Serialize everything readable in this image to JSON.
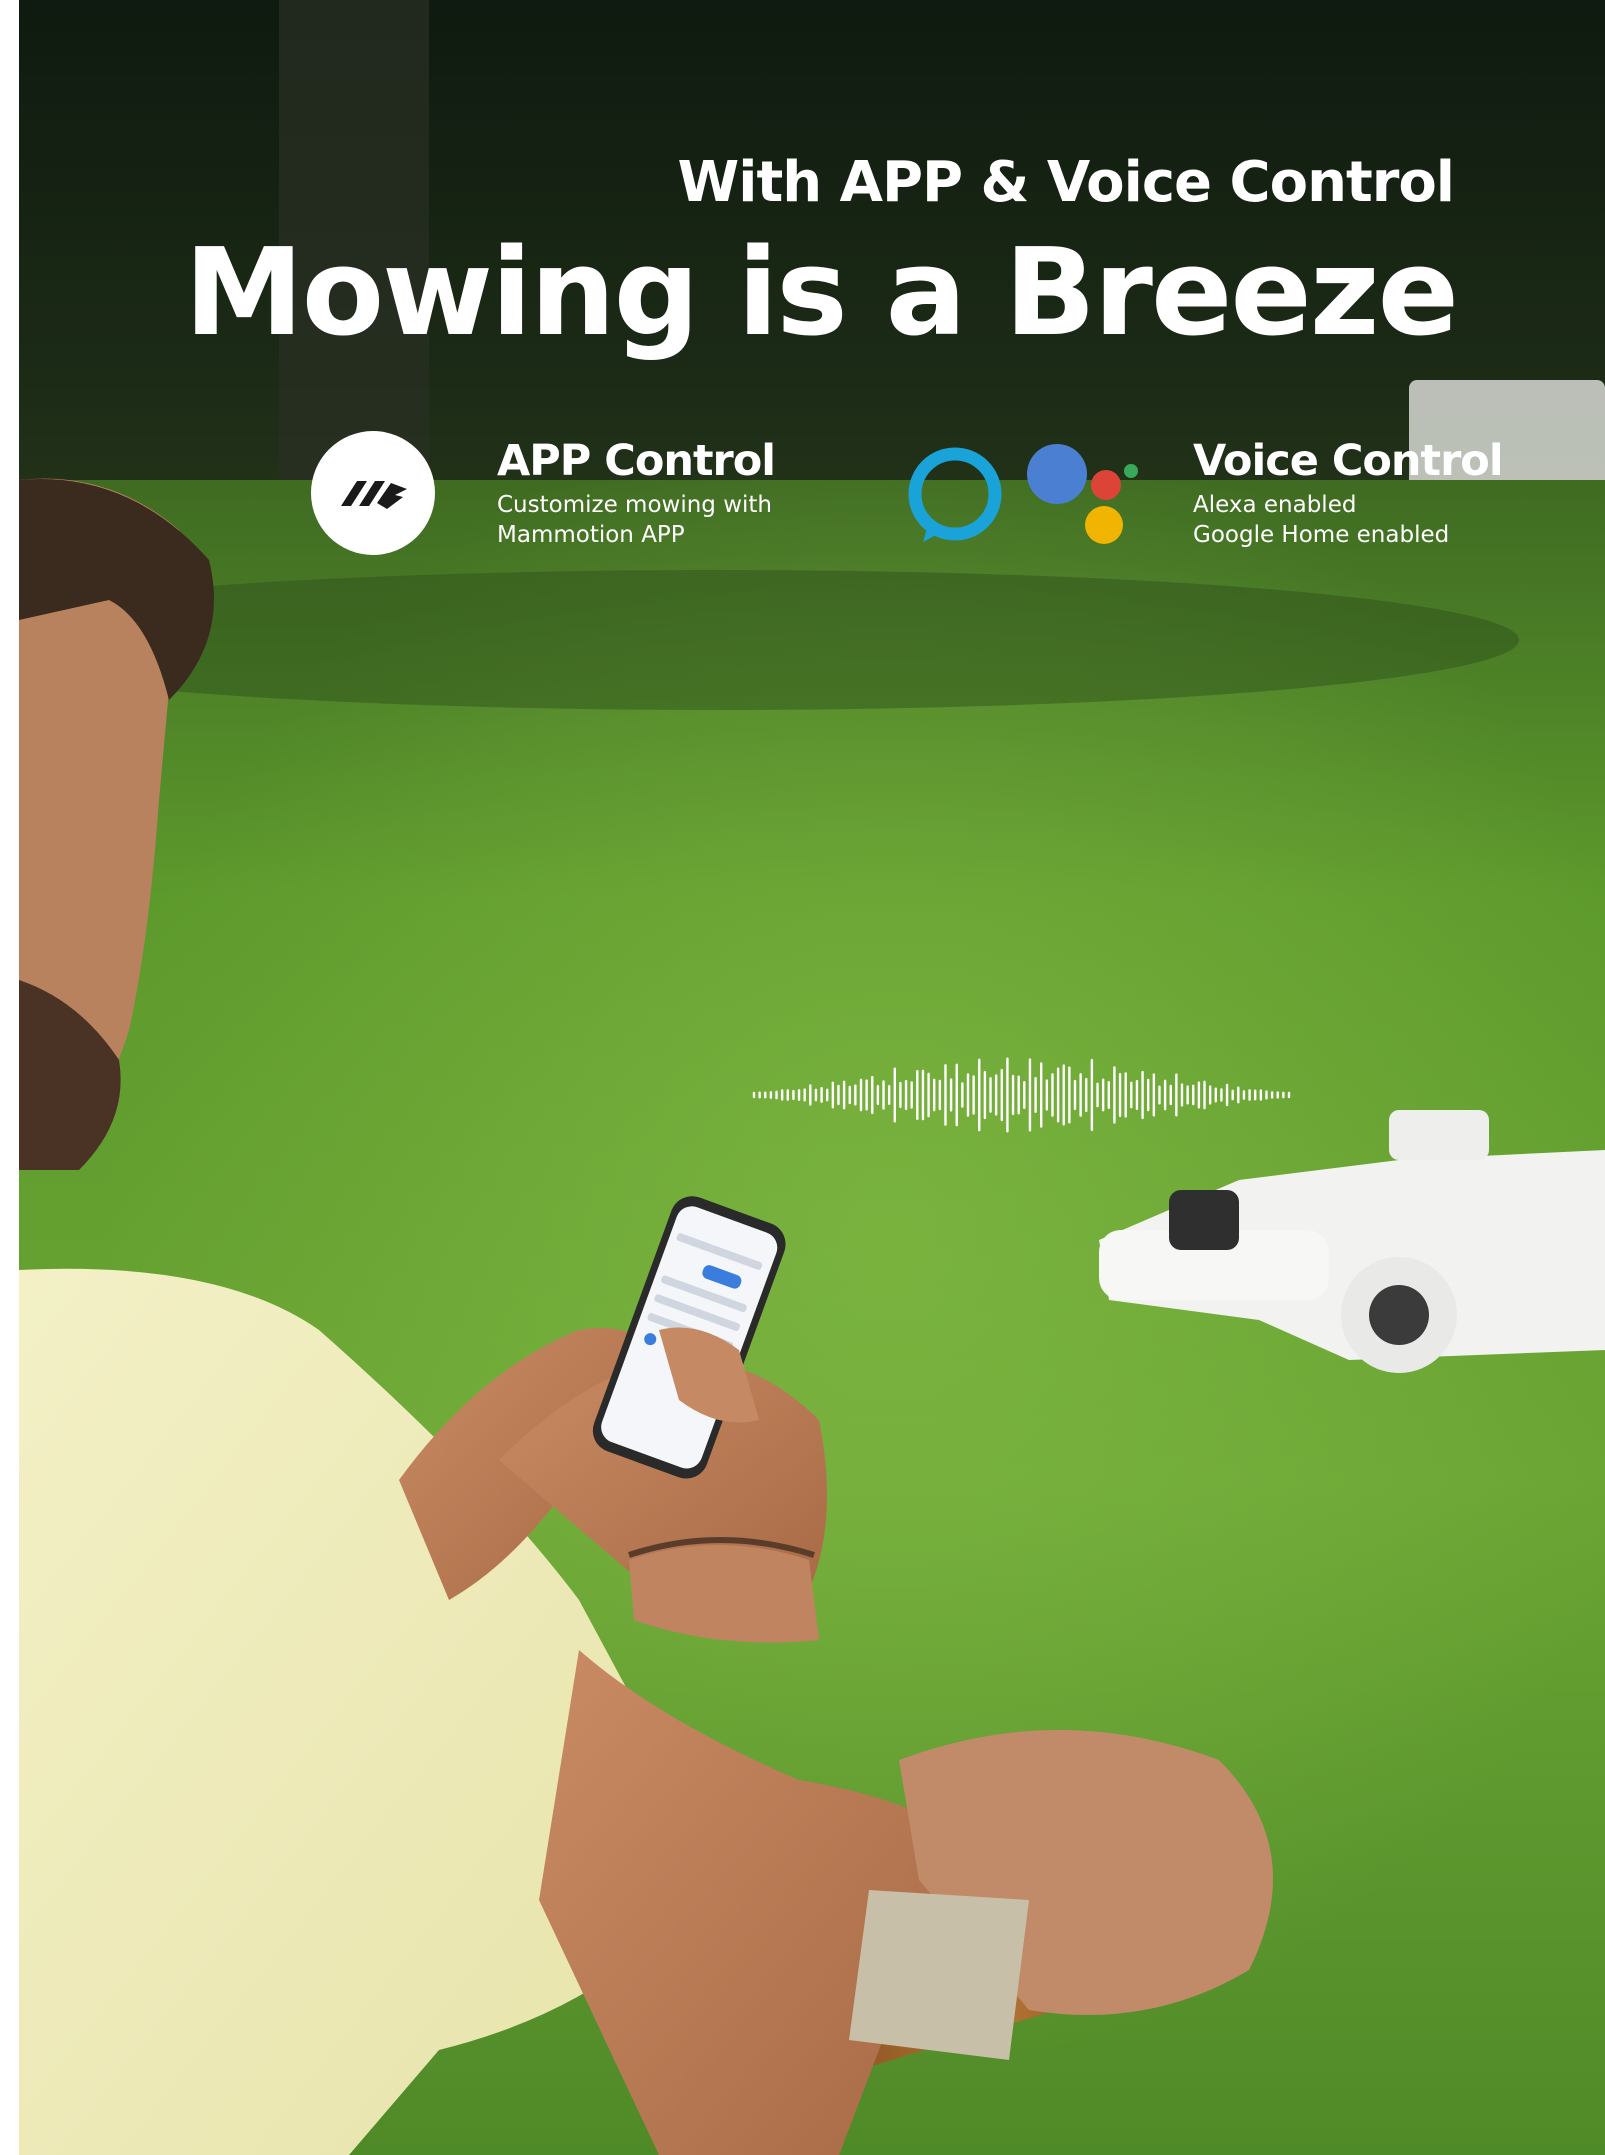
{
  "headline": {
    "subtitle": "With APP & Voice Control",
    "title": "Mowing is a Breeze"
  },
  "app_control": {
    "title": "APP Control",
    "description_line1": "Customize mowing with",
    "description_line2": "Mammotion APP",
    "icon": "mammotion-logo-icon"
  },
  "voice_control": {
    "title": "Voice Control",
    "line1": "Alexa enabled",
    "line2": "Google Home enabled",
    "icons": [
      "alexa-ring-icon",
      "google-assistant-dots-icon"
    ]
  },
  "colors": {
    "text": "#ffffff",
    "alexa_blue": "#1aa3d8",
    "google_blue": "#4a7fd1",
    "google_red": "#db4437",
    "google_yellow": "#f1b400",
    "google_green": "#3aa85a",
    "lawn": "#5f9a2c",
    "hedge": "#1d2d18"
  },
  "scene_description_icons": [
    "voice-waveform-icon",
    "phone-icon",
    "robot-mower-icon"
  ]
}
